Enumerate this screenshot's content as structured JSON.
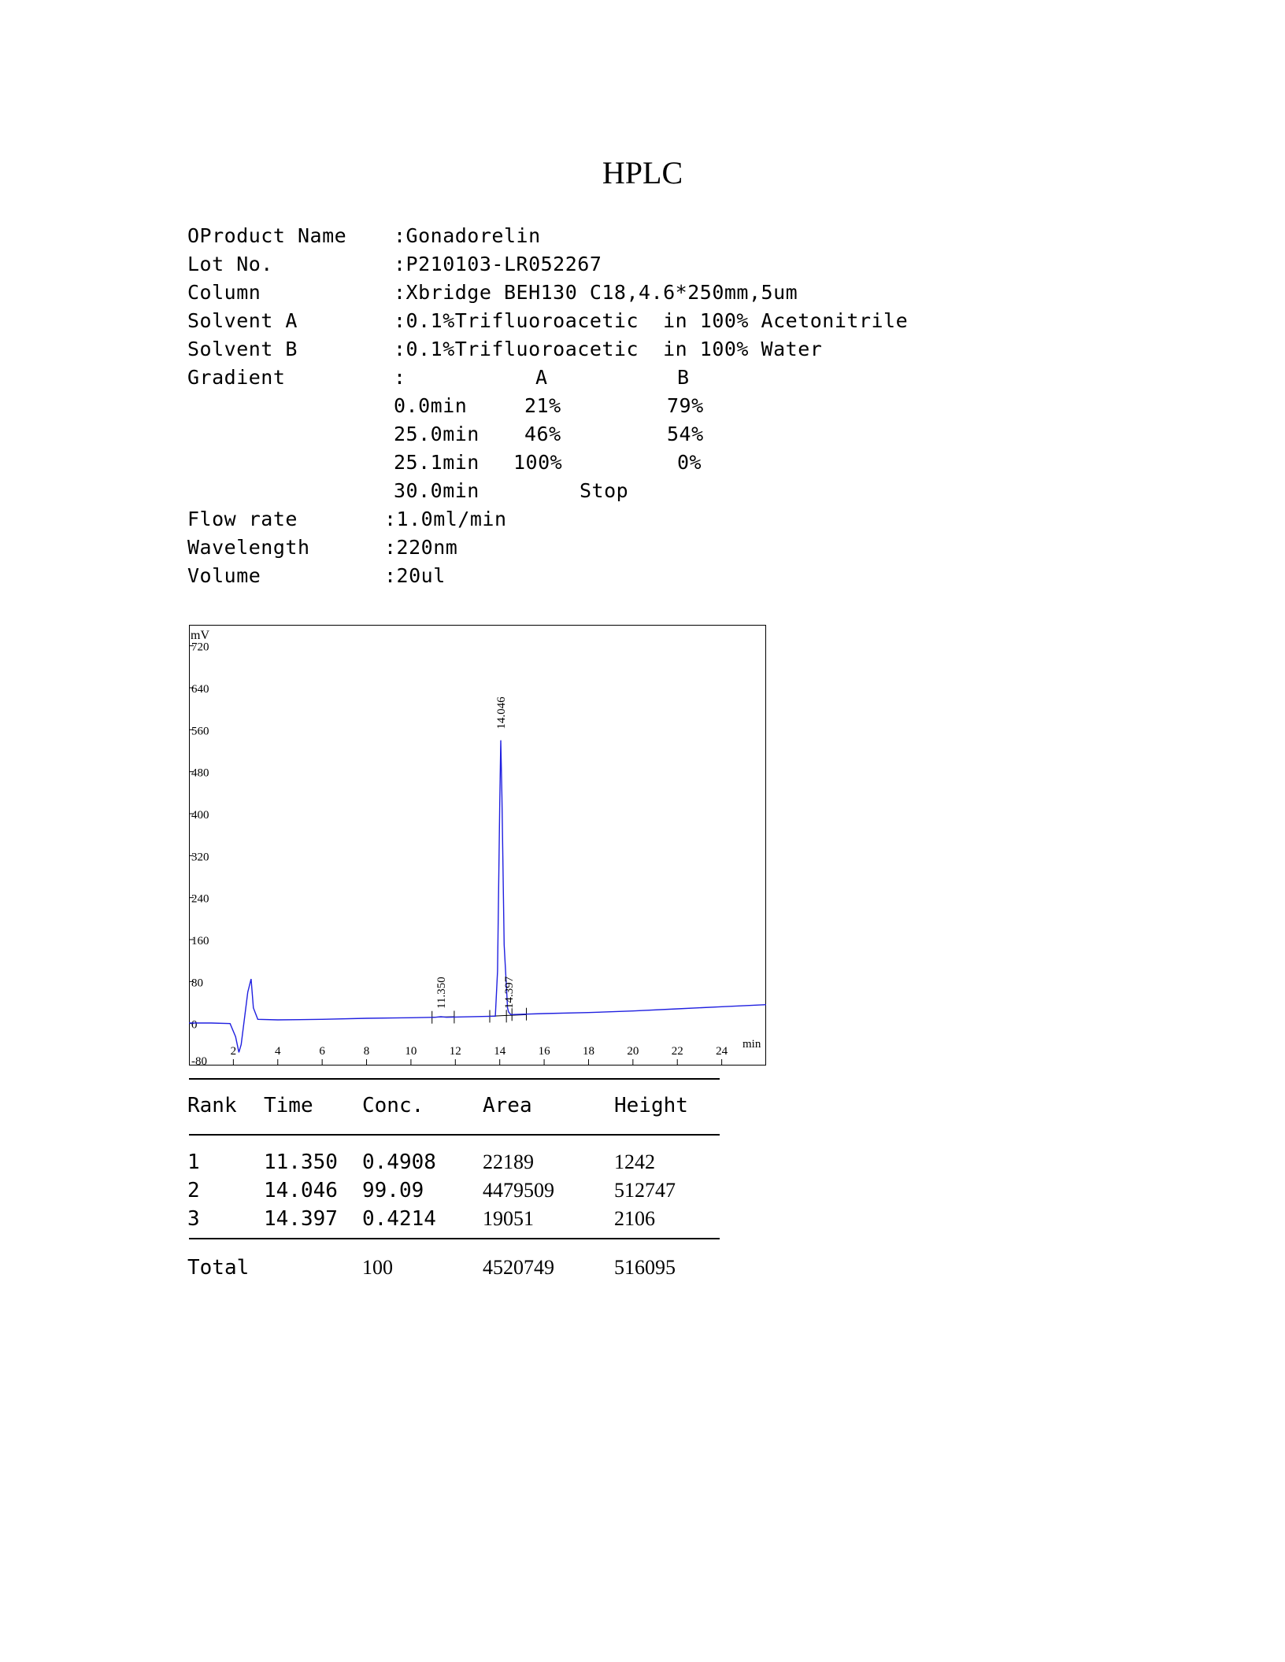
{
  "title": "HPLC",
  "info": [
    {
      "label": "OProduct Name",
      "value": ":Gonadorelin"
    },
    {
      "label": "Lot No.",
      "value": ":P210103-LR052267"
    },
    {
      "label": "Column",
      "value": ":Xbridge BEH130 C18,4.6*250mm,5um"
    },
    {
      "label": "Solvent A",
      "value": ":0.1%Trifluoroacetic  in 100% Acetonitrile"
    },
    {
      "label": "Solvent B",
      "value": ":0.1%Trifluoroacetic  in 100% Water"
    },
    {
      "label": "Gradient",
      "value": ":"
    }
  ],
  "gradient": {
    "header_a": "A",
    "header_b": "B",
    "rows": [
      {
        "time": "0.0min",
        "a": "21%",
        "b": "79%"
      },
      {
        "time": "25.0min",
        "a": "46%",
        "b": "54%"
      },
      {
        "time": "25.1min",
        "a": "100%",
        "b": "0%"
      },
      {
        "time": "30.0min",
        "stop": "Stop"
      }
    ]
  },
  "info2": [
    {
      "label": "Flow rate",
      "value": ":1.0ml/min"
    },
    {
      "label": "Wavelength",
      "value": ":220nm"
    },
    {
      "label": "Volume",
      "value": ":20ul"
    }
  ],
  "chart_data": {
    "type": "line",
    "ylabel": "mV",
    "xlabel": "min",
    "xlim": [
      0,
      26
    ],
    "ylim": [
      -80,
      760
    ],
    "xticks": [
      2,
      4,
      6,
      8,
      10,
      12,
      14,
      16,
      18,
      20,
      22,
      24
    ],
    "yticks": [
      -80,
      0,
      80,
      160,
      240,
      320,
      400,
      480,
      560,
      640,
      720
    ],
    "series": [
      {
        "color": "#2020e0",
        "x": [
          0,
          1.0,
          1.85,
          2.1,
          2.25,
          2.35,
          2.5,
          2.65,
          2.8,
          2.9,
          3.1,
          4,
          6,
          8,
          10,
          11.1,
          11.35,
          11.6,
          13.8,
          13.9,
          14.0,
          14.046,
          14.1,
          14.2,
          14.35,
          14.397,
          14.5,
          16,
          18,
          20,
          22,
          24,
          26
        ],
        "y": [
          1,
          1,
          0,
          -25,
          -55,
          -40,
          10,
          60,
          85,
          30,
          8,
          7,
          8,
          10,
          11,
          12,
          13,
          12,
          14,
          100,
          420,
          540,
          430,
          150,
          30,
          22,
          17,
          19,
          21,
          24,
          28,
          32,
          36
        ]
      }
    ],
    "peak_labels": [
      "11.350",
      "14.046",
      "14.397"
    ],
    "peak_label_x": [
      11.35,
      14.046,
      14.397
    ],
    "integration_marks_x": [
      10.95,
      11.95,
      13.55,
      14.3,
      14.55,
      15.2
    ]
  },
  "results": {
    "headers": [
      "Rank",
      "Time",
      "Conc.",
      "Area",
      "Height"
    ],
    "rows": [
      [
        "1",
        "11.350",
        "0.4908",
        "22189",
        "1242"
      ],
      [
        "2",
        "14.046",
        "99.09",
        "4479509",
        "512747"
      ],
      [
        "3",
        "14.397",
        "0.4214",
        "19051",
        "2106"
      ]
    ],
    "total": {
      "label": "Total",
      "conc": "100",
      "area": "4520749",
      "height": "516095"
    }
  }
}
